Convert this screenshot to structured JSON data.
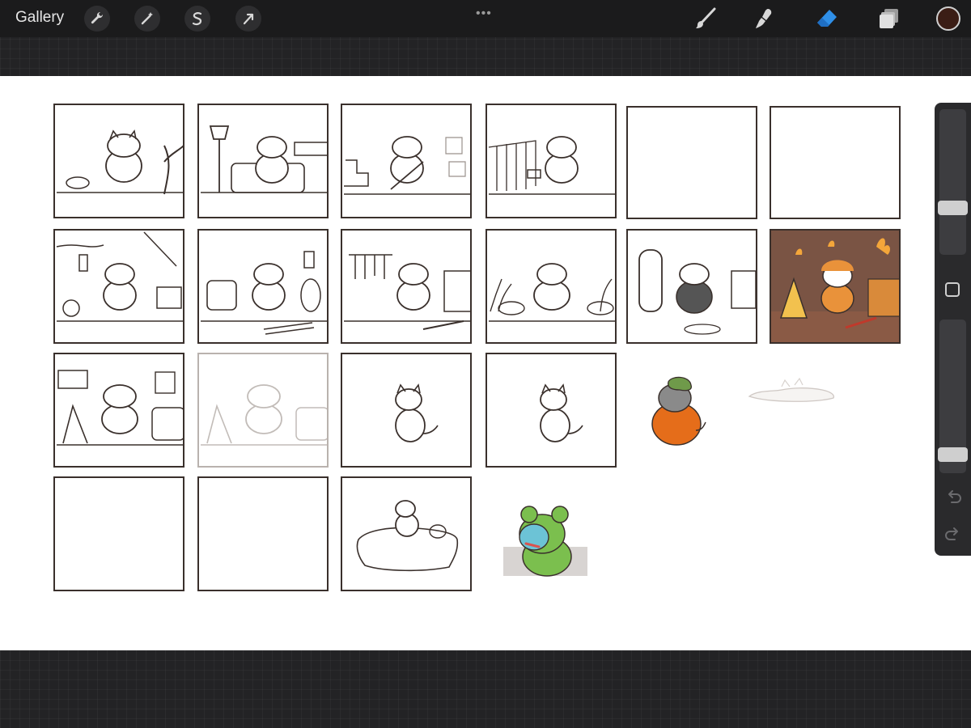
{
  "topbar": {
    "gallery_label": "Gallery",
    "left_tools": [
      "wrench-icon",
      "magic-wand-icon",
      "selection-icon",
      "transform-arrow-icon"
    ],
    "more_label": "•••",
    "right_tools": [
      "brush-icon",
      "smudge-icon",
      "eraser-icon",
      "layers-icon"
    ],
    "active_tool": "eraser-icon",
    "current_color": "#3b1d15"
  },
  "canvas": {
    "panels": [
      {
        "row": 1,
        "col": 1,
        "content": "sketch"
      },
      {
        "row": 1,
        "col": 2,
        "content": "sketch"
      },
      {
        "row": 1,
        "col": 3,
        "content": "sketch"
      },
      {
        "row": 1,
        "col": 4,
        "content": "sketch"
      },
      {
        "row": 1,
        "col": 5,
        "content": "empty"
      },
      {
        "row": 1,
        "col": 6,
        "content": "empty"
      },
      {
        "row": 2,
        "col": 1,
        "content": "sketch"
      },
      {
        "row": 2,
        "col": 2,
        "content": "sketch"
      },
      {
        "row": 2,
        "col": 3,
        "content": "sketch"
      },
      {
        "row": 2,
        "col": 4,
        "content": "sketch"
      },
      {
        "row": 2,
        "col": 5,
        "content": "sketch"
      },
      {
        "row": 2,
        "col": 6,
        "content": "colored"
      },
      {
        "row": 3,
        "col": 1,
        "content": "sketch"
      },
      {
        "row": 3,
        "col": 2,
        "content": "faded-sketch"
      },
      {
        "row": 3,
        "col": 3,
        "content": "character"
      },
      {
        "row": 3,
        "col": 4,
        "content": "character"
      },
      {
        "row": 4,
        "col": 1,
        "content": "empty"
      },
      {
        "row": 4,
        "col": 2,
        "content": "empty"
      },
      {
        "row": 4,
        "col": 3,
        "content": "sketch"
      }
    ],
    "stickers": [
      "pumpkin-hoodie-character",
      "cloud-puddle",
      "frog-hoodie-character"
    ]
  },
  "sidebar": {
    "brush_size_level": 0.3,
    "opacity_level": 0.08,
    "undo_icon": "undo-icon",
    "redo_icon": "redo-icon"
  }
}
